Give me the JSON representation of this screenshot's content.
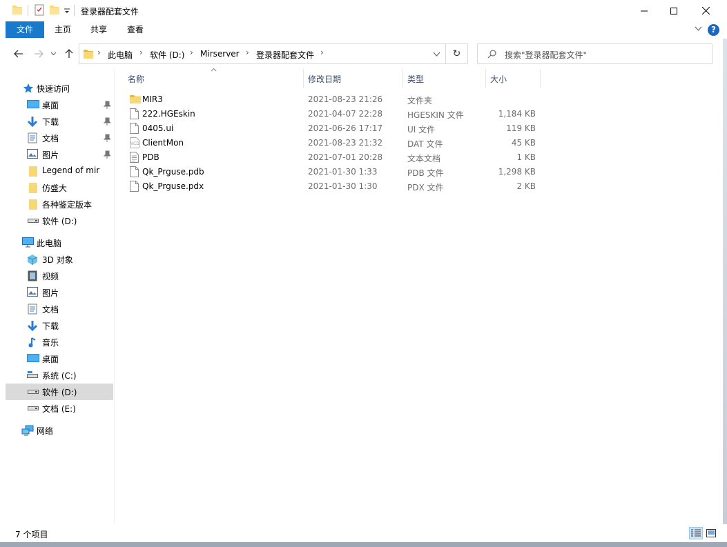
{
  "window": {
    "title": "登录器配套文件"
  },
  "ribbon": {
    "tabs": [
      "文件",
      "主页",
      "共享",
      "查看"
    ],
    "help": "?"
  },
  "address": {
    "crumbs": [
      "此电脑",
      "软件 (D:)",
      "Mirserver",
      "登录器配套文件"
    ]
  },
  "search": {
    "placeholder": "搜索\"登录器配套文件\""
  },
  "sidebar": {
    "items": [
      {
        "label": "快速访问",
        "icon": "star-icon",
        "pinned": false
      },
      {
        "label": "桌面",
        "icon": "desktop-icon",
        "pinned": true
      },
      {
        "label": "下载",
        "icon": "download-icon",
        "pinned": true
      },
      {
        "label": "文档",
        "icon": "document-icon",
        "pinned": true
      },
      {
        "label": "图片",
        "icon": "picture-icon",
        "pinned": true
      },
      {
        "label": "Legend of mir",
        "icon": "folder-icon",
        "pinned": false
      },
      {
        "label": "仿盛大",
        "icon": "folder-icon",
        "pinned": false
      },
      {
        "label": "各种鉴定版本",
        "icon": "folder-icon",
        "pinned": false
      },
      {
        "label": "软件 (D:)",
        "icon": "drive-icon",
        "pinned": false
      },
      {
        "label": "此电脑",
        "icon": "computer-icon",
        "pinned": false
      },
      {
        "label": "3D 对象",
        "icon": "cube-icon",
        "pinned": false
      },
      {
        "label": "视频",
        "icon": "video-icon",
        "pinned": false
      },
      {
        "label": "图片",
        "icon": "picture-icon",
        "pinned": false
      },
      {
        "label": "文档",
        "icon": "document-icon",
        "pinned": false
      },
      {
        "label": "下载",
        "icon": "download-icon",
        "pinned": false
      },
      {
        "label": "音乐",
        "icon": "music-icon",
        "pinned": false
      },
      {
        "label": "桌面",
        "icon": "desktop-icon",
        "pinned": false
      },
      {
        "label": "系统 (C:)",
        "icon": "drive-icon",
        "pinned": false
      },
      {
        "label": "软件 (D:)",
        "icon": "drive-icon",
        "pinned": false,
        "selected": true
      },
      {
        "label": "文档 (E:)",
        "icon": "drive-icon",
        "pinned": false
      },
      {
        "label": "网络",
        "icon": "network-icon",
        "pinned": false
      }
    ]
  },
  "columns": {
    "name": "名称",
    "date": "修改日期",
    "type": "类型",
    "size": "大小"
  },
  "files": [
    {
      "name": "MIR3",
      "date": "2021-08-23 21:26",
      "type": "文件夹",
      "size": "",
      "icon": "folder-icon"
    },
    {
      "name": "222.HGEskin",
      "date": "2021-04-07 22:28",
      "type": "HGESKIN 文件",
      "size": "1,184 KB",
      "icon": "file-icon"
    },
    {
      "name": "0405.ui",
      "date": "2021-06-26 17:17",
      "type": "UI 文件",
      "size": "119 KB",
      "icon": "file-icon"
    },
    {
      "name": "ClientMon",
      "date": "2021-08-23 21:32",
      "type": "DAT 文件",
      "size": "45 KB",
      "icon": "dat-file-icon"
    },
    {
      "name": "PDB",
      "date": "2021-07-01 20:28",
      "type": "文本文档",
      "size": "1 KB",
      "icon": "text-file-icon"
    },
    {
      "name": "Qk_Prguse.pdb",
      "date": "2021-01-30 1:33",
      "type": "PDB 文件",
      "size": "1,298 KB",
      "icon": "file-icon"
    },
    {
      "name": "Qk_Prguse.pdx",
      "date": "2021-01-30 1:30",
      "type": "PDX 文件",
      "size": "2 KB",
      "icon": "file-icon"
    }
  ],
  "status": {
    "count": "7 个项目"
  },
  "colors": {
    "accent": "#1979ca",
    "folder": "#f8d775",
    "selected": "#dadada"
  }
}
